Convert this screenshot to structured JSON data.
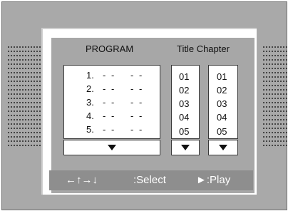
{
  "menu": {
    "program_heading": "PROGRAM",
    "title_chapter_heading": "Title Chapter",
    "program_rows": [
      {
        "index": "1.",
        "title": "- -",
        "chapter": "- -"
      },
      {
        "index": "2.",
        "title": "- -",
        "chapter": "- -"
      },
      {
        "index": "3.",
        "title": "- -",
        "chapter": "- -"
      },
      {
        "index": "4.",
        "title": "- -",
        "chapter": "- -"
      },
      {
        "index": "5.",
        "title": "- -",
        "chapter": "- -"
      }
    ],
    "title_values": [
      "01",
      "02",
      "03",
      "04",
      "05"
    ],
    "chapter_values": [
      "01",
      "02",
      "03",
      "04",
      "05"
    ],
    "footer": {
      "arrows": "←↑→↓",
      "select_label": ":Select",
      "play_label": "►:Play"
    }
  },
  "icons": {
    "scroll_down": "down-triangle-icon"
  },
  "colors": {
    "screen_bg": "#a9a9a9",
    "panel_bg": "#a7a7a7",
    "footer_bg": "#8e8e8e",
    "text": "#111111"
  }
}
